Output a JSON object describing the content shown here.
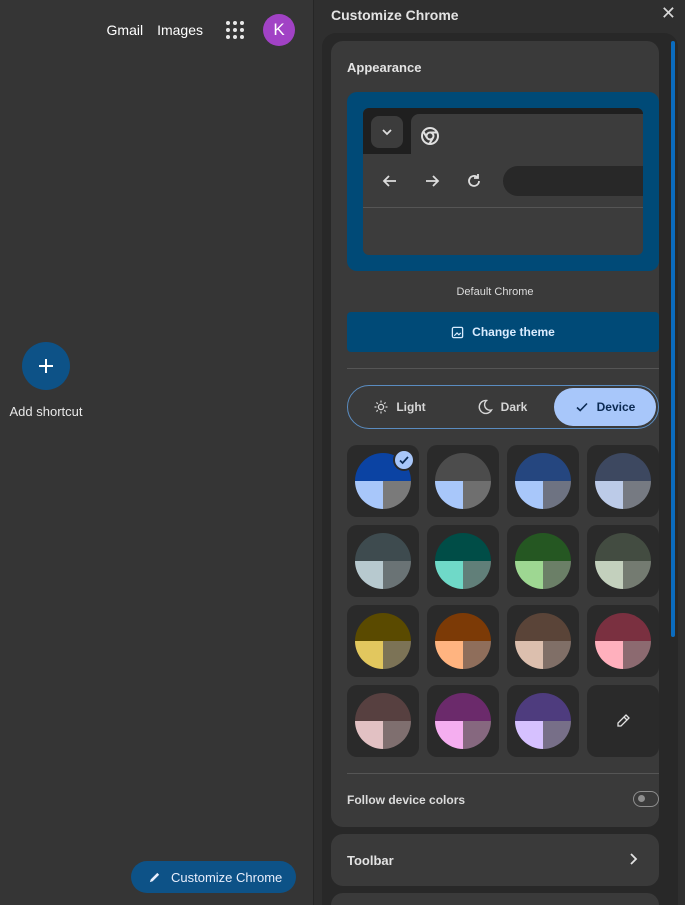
{
  "ntp": {
    "links": {
      "gmail": "Gmail",
      "images": "Images"
    },
    "avatar_letter": "K",
    "avatar_color": "#a142c5",
    "shortcut": {
      "label": "Add shortcut",
      "icon": "plus-icon"
    },
    "customize_button": {
      "label": "Customize Chrome",
      "icon": "pencil-icon"
    }
  },
  "panel": {
    "title": "Customize Chrome",
    "close_icon": "close-icon",
    "appearance": {
      "title": "Appearance",
      "theme_name": "Default Chrome",
      "change_theme_label": "Change theme",
      "modes": [
        {
          "label": "Light",
          "icon": "sun-icon",
          "selected": false
        },
        {
          "label": "Dark",
          "icon": "moon-icon",
          "selected": false
        },
        {
          "label": "Device",
          "icon": "check-icon",
          "selected": true
        }
      ],
      "swatches": [
        {
          "top": "#0b43a3",
          "bl": "#a8c7fa",
          "br": "#7a7a7a",
          "selected": true
        },
        {
          "top": "#4c4c4c",
          "bl": "#a8c7fa",
          "br": "#6f6f6f",
          "selected": false
        },
        {
          "top": "#25467f",
          "bl": "#a8c7fa",
          "br": "#6e7382",
          "selected": false
        },
        {
          "top": "#3d4860",
          "bl": "#bccbe8",
          "br": "#767a82",
          "selected": false
        },
        {
          "top": "#3e4b4f",
          "bl": "#b7c9cf",
          "br": "#6a7375",
          "selected": false
        },
        {
          "top": "#004d47",
          "bl": "#6fd9c8",
          "br": "#617f79",
          "selected": false
        },
        {
          "top": "#255722",
          "bl": "#9ed792",
          "br": "#6b7f67",
          "selected": false
        },
        {
          "top": "#434c41",
          "bl": "#c3d0bd",
          "br": "#747b71",
          "selected": false
        },
        {
          "top": "#5a4a00",
          "bl": "#e2c75e",
          "br": "#7c7356",
          "selected": false
        },
        {
          "top": "#7c3a06",
          "bl": "#ffb480",
          "br": "#8f6e5b",
          "selected": false
        },
        {
          "top": "#5a4438",
          "bl": "#dcbfae",
          "br": "#806f67",
          "selected": false
        },
        {
          "top": "#7a3040",
          "bl": "#ffb0bd",
          "br": "#8c6a70",
          "selected": false
        },
        {
          "top": "#574040",
          "bl": "#e2c1c3",
          "br": "#7f6f6f",
          "selected": false
        },
        {
          "top": "#6b2a6b",
          "bl": "#f5aef0",
          "br": "#86687f",
          "selected": false
        },
        {
          "top": "#4e3c7e",
          "bl": "#d6c1ff",
          "br": "#776f88",
          "selected": false
        }
      ],
      "custom_color_icon": "eyedropper-icon",
      "follow_device_label": "Follow device colors",
      "follow_device_on": false
    },
    "toolbar_label": "Toolbar",
    "accent": "#0b6cbf"
  }
}
